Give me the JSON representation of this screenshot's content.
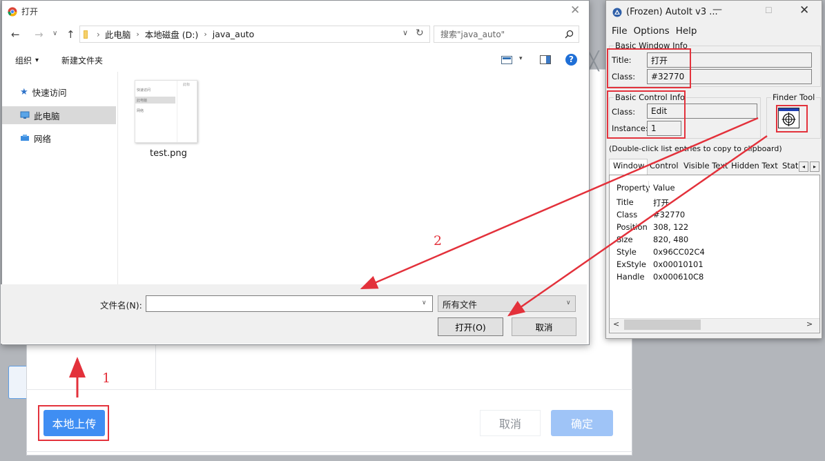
{
  "background_page": {
    "close_glyph": "╳",
    "local_upload_label": "本地上传",
    "cancel_label": "取消",
    "ok_label": "确定"
  },
  "open_dialog": {
    "title": "打开",
    "close_glyph": "✕",
    "nav": {
      "back": "←",
      "forward": "→",
      "recent": "∨",
      "up": "↑"
    },
    "address": {
      "crumbs": [
        "此电脑",
        "本地磁盘 (D:)",
        "java_auto"
      ],
      "dropdown": "∨",
      "refresh": "↻"
    },
    "search_placeholder": "搜索\"java_auto\"",
    "toolbar": {
      "organize": "组织",
      "organize_caret": "▾",
      "new_folder": "新建文件夹",
      "view_caret": "▾",
      "help": "?"
    },
    "nav_pane": [
      {
        "label": "快速访问",
        "icon": "star-icon"
      },
      {
        "label": "此电脑",
        "icon": "computer-icon",
        "selected": true
      },
      {
        "label": "网络",
        "icon": "network-icon"
      }
    ],
    "files": [
      {
        "name": "test.png",
        "icon": "image-thumbnail"
      }
    ],
    "thumbnail_text": {
      "corner": "此标",
      "rows": [
        "快速访问",
        "此电脑",
        "网络"
      ]
    },
    "filename_label": "文件名(N):",
    "filename_value": "",
    "filetype_value": "所有文件",
    "dropdown_glyph": "∨",
    "open_button": "打开(O)",
    "cancel_button": "取消"
  },
  "autoit": {
    "title": "(Frozen) AutoIt v3 ...",
    "window_controls": {
      "minimize": "—",
      "maximize": "☐",
      "close": "✕"
    },
    "menu": [
      "File",
      "Options",
      "Help"
    ],
    "basic_window_info": {
      "group_title": "Basic Window Info",
      "title_label": "Title:",
      "title_value": "打开",
      "class_label": "Class:",
      "class_value": "#32770"
    },
    "basic_control_info": {
      "group_title": "Basic Control Info",
      "class_label": "Class:",
      "class_value": "Edit",
      "instance_label": "Instance:",
      "instance_value": "1"
    },
    "finder_tool_label": "Finder Tool",
    "hint": "(Double-click list entries to copy to clipboard)",
    "tabs": [
      "Window",
      "Control",
      "Visible Text",
      "Hidden Text",
      "Stat"
    ],
    "tab_scroll": {
      "left": "◂",
      "right": "▸"
    },
    "active_tab": "Window",
    "list_headers": [
      "Property",
      "Value"
    ],
    "list_rows": [
      [
        "Title",
        "打开"
      ],
      [
        "Class",
        "#32770"
      ],
      [
        "Position",
        "308, 122"
      ],
      [
        "Size",
        "820, 480"
      ],
      [
        "Style",
        "0x96CC02C4"
      ],
      [
        "ExStyle",
        "0x00010101"
      ],
      [
        "Handle",
        "0x000610C8"
      ]
    ],
    "hscroll": {
      "left": "<",
      "right": ">"
    }
  },
  "annotations": {
    "step1": "1",
    "step2": "2",
    "color": "#e3313b"
  }
}
